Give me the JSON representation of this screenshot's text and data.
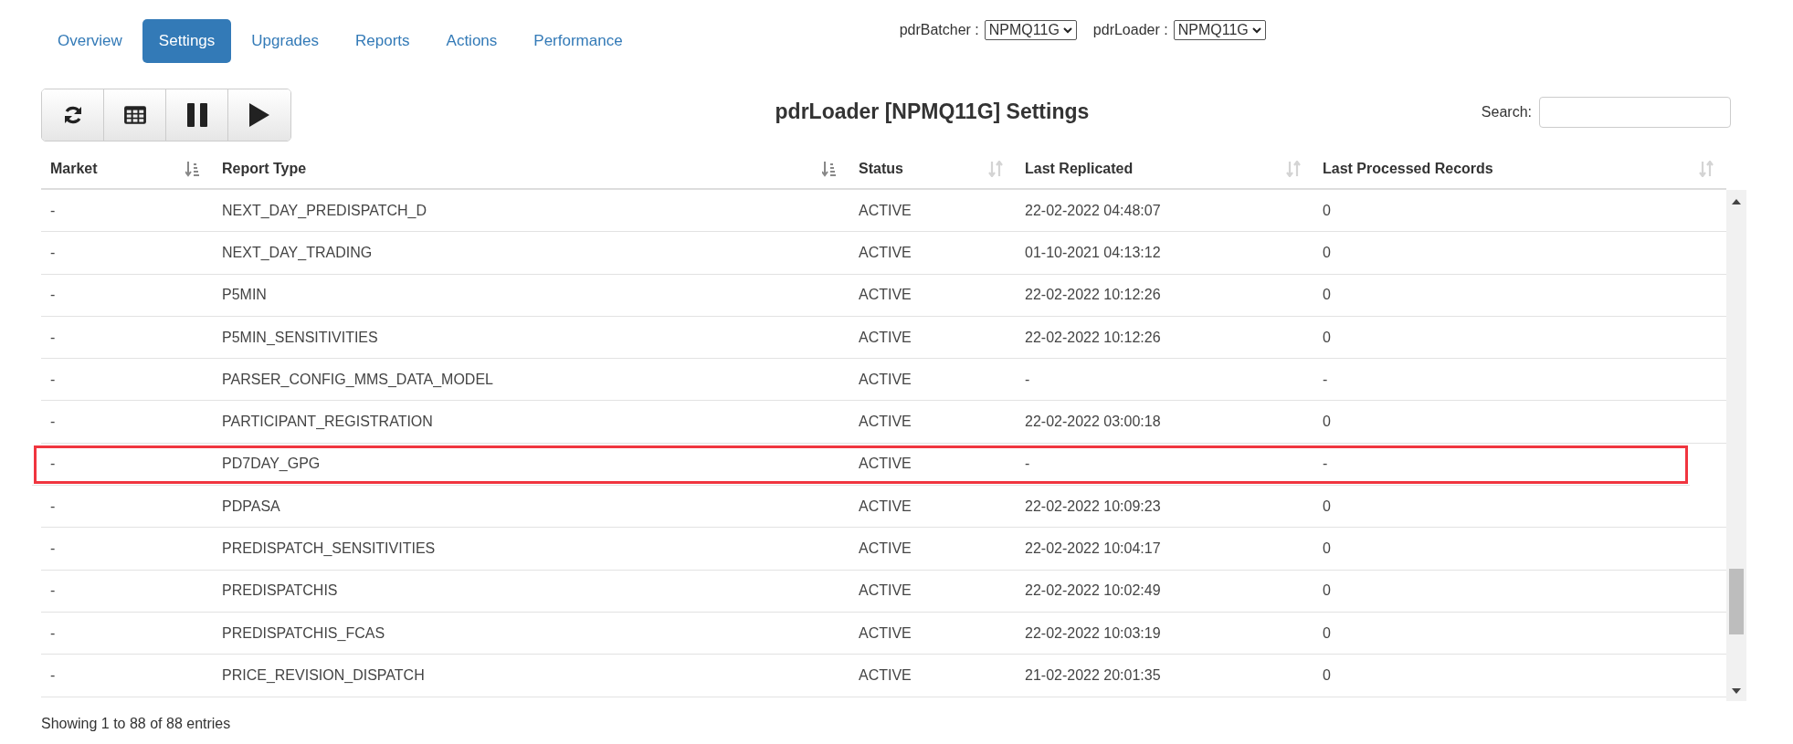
{
  "tabs": [
    {
      "label": "Overview",
      "selected": false
    },
    {
      "label": "Settings",
      "selected": true
    },
    {
      "label": "Upgrades",
      "selected": false
    },
    {
      "label": "Reports",
      "selected": false
    },
    {
      "label": "Actions",
      "selected": false
    },
    {
      "label": "Performance",
      "selected": false
    }
  ],
  "selectors": [
    {
      "label": "pdrBatcher :",
      "value": "NPMQ11G"
    },
    {
      "label": "pdrLoader :",
      "value": "NPMQ11G"
    }
  ],
  "toolbar": [
    {
      "kind": "refresh"
    },
    {
      "kind": "table"
    },
    {
      "kind": "pause"
    },
    {
      "kind": "play"
    }
  ],
  "title": "pdrLoader [NPMQ11G] Settings",
  "search": {
    "label": "Search:"
  },
  "table": {
    "columns": [
      {
        "label": "Market",
        "sorted": true
      },
      {
        "label": "Report Type",
        "sorted": true
      },
      {
        "label": "Status",
        "sorted": false
      },
      {
        "label": "Last Replicated",
        "sorted": false
      },
      {
        "label": "Last Processed Records",
        "sorted": false
      }
    ],
    "rows": [
      {
        "cells": [
          "-",
          "NEXT_DAY_PREDISPATCH_D",
          "ACTIVE",
          "22-02-2022 04:48:07",
          "0"
        ],
        "highlighted": false
      },
      {
        "cells": [
          "-",
          "NEXT_DAY_TRADING",
          "ACTIVE",
          "01-10-2021 04:13:12",
          "0"
        ],
        "highlighted": false
      },
      {
        "cells": [
          "-",
          "P5MIN",
          "ACTIVE",
          "22-02-2022 10:12:26",
          "0"
        ],
        "highlighted": false
      },
      {
        "cells": [
          "-",
          "P5MIN_SENSITIVITIES",
          "ACTIVE",
          "22-02-2022 10:12:26",
          "0"
        ],
        "highlighted": false
      },
      {
        "cells": [
          "-",
          "PARSER_CONFIG_MMS_DATA_MODEL",
          "ACTIVE",
          "-",
          "-"
        ],
        "highlighted": false
      },
      {
        "cells": [
          "-",
          "PARTICIPANT_REGISTRATION",
          "ACTIVE",
          "22-02-2022 03:00:18",
          "0"
        ],
        "highlighted": false
      },
      {
        "cells": [
          "-",
          "PD7DAY_GPG",
          "ACTIVE",
          "-",
          "-"
        ],
        "highlighted": true
      },
      {
        "cells": [
          "-",
          "PDPASA",
          "ACTIVE",
          "22-02-2022 10:09:23",
          "0"
        ],
        "highlighted": false
      },
      {
        "cells": [
          "-",
          "PREDISPATCH_SENSITIVITIES",
          "ACTIVE",
          "22-02-2022 10:04:17",
          "0"
        ],
        "highlighted": false
      },
      {
        "cells": [
          "-",
          "PREDISPATCHIS",
          "ACTIVE",
          "22-02-2022 10:02:49",
          "0"
        ],
        "highlighted": false
      },
      {
        "cells": [
          "-",
          "PREDISPATCHIS_FCAS",
          "ACTIVE",
          "22-02-2022 10:03:19",
          "0"
        ],
        "highlighted": false
      },
      {
        "cells": [
          "-",
          "PRICE_REVISION_DISPATCH",
          "ACTIVE",
          "21-02-2022 20:01:35",
          "0"
        ],
        "highlighted": false
      }
    ]
  },
  "footer": "Showing 1 to 88 of 88 entries"
}
